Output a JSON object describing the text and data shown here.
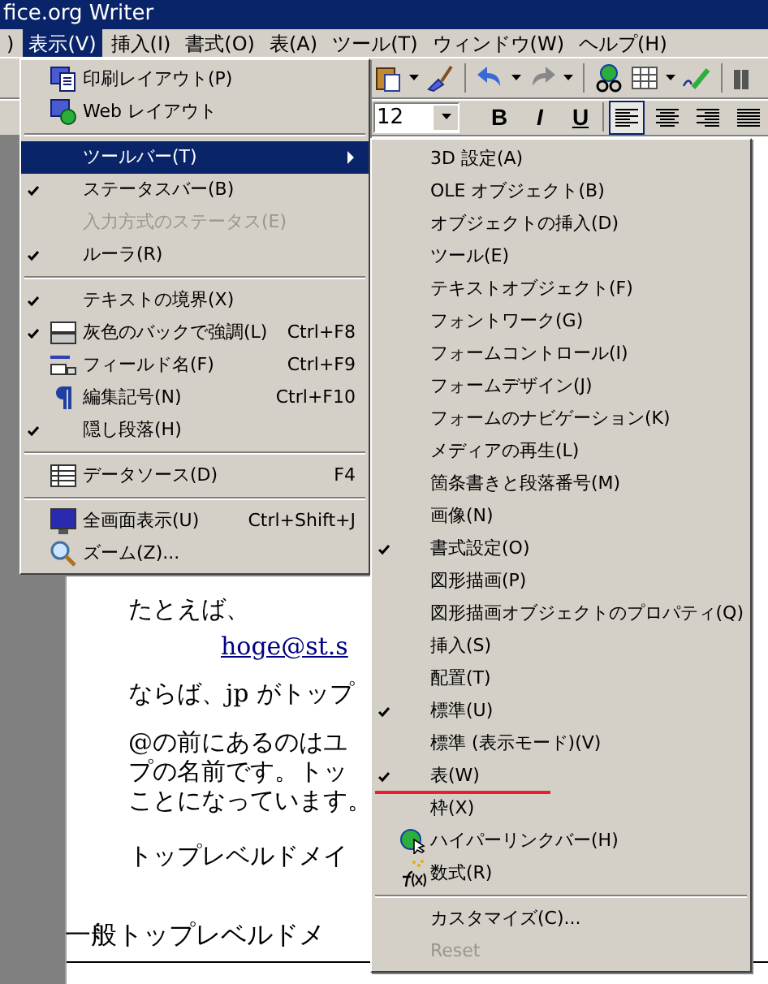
{
  "window": {
    "title": "fice.org Writer"
  },
  "menu_bar": [
    {
      "label": ")",
      "selected": false
    },
    {
      "label": "表示(V)",
      "selected": true
    },
    {
      "label": "挿入(I)",
      "selected": false
    },
    {
      "label": "書式(O)",
      "selected": false
    },
    {
      "label": "表(A)",
      "selected": false
    },
    {
      "label": "ツール(T)",
      "selected": false
    },
    {
      "label": "ウィンドウ(W)",
      "selected": false
    },
    {
      "label": "ヘルプ(H)",
      "selected": false
    }
  ],
  "format_bar": {
    "font_size": "12",
    "text_buttons": [
      {
        "label": "B",
        "pressed": false
      },
      {
        "label": "I",
        "pressed": false
      },
      {
        "label": "U",
        "pressed": false
      }
    ],
    "align_buttons": [
      {
        "selected": true
      },
      {
        "selected": false
      },
      {
        "selected": false
      },
      {
        "selected": false
      }
    ]
  },
  "document": {
    "blocks": [
      {
        "kind": "text",
        "lines": [
          "たとえば、"
        ]
      },
      {
        "kind": "link",
        "lines": [
          "hoge@st.s"
        ]
      },
      {
        "kind": "text",
        "lines": [
          "ならば、jp がトップ"
        ]
      },
      {
        "kind": "text",
        "lines": [
          "@の前にあるのはユ",
          "プの名前です。トッ",
          "ことになっています。"
        ]
      },
      {
        "kind": "text",
        "lines": [
          "トップレベルドメイ"
        ]
      },
      {
        "kind": "heading",
        "lines": [
          "一般トップレベルドメ"
        ]
      }
    ]
  },
  "view_menu": [
    {
      "kind": "item",
      "label": "印刷レイアウト(P)",
      "checked": false,
      "disabled": false,
      "selected": false
    },
    {
      "kind": "item",
      "label": "Web レイアウト",
      "checked": false,
      "disabled": false,
      "selected": false
    },
    {
      "kind": "separator"
    },
    {
      "kind": "submenu",
      "label": "ツールバー(T)",
      "checked": false,
      "disabled": false,
      "selected": true
    },
    {
      "kind": "item",
      "label": "ステータスバー(B)",
      "checked": true,
      "disabled": false,
      "selected": false
    },
    {
      "kind": "item",
      "label": "入力方式のステータス(E)",
      "checked": false,
      "disabled": true,
      "selected": false
    },
    {
      "kind": "item",
      "label": "ルーラ(R)",
      "checked": true,
      "disabled": false,
      "selected": false
    },
    {
      "kind": "separator"
    },
    {
      "kind": "item",
      "label": "テキストの境界(X)",
      "checked": true,
      "disabled": false,
      "selected": false
    },
    {
      "kind": "item",
      "label": "灰色のバックで強調(L)",
      "shortcut": "Ctrl+F8",
      "checked": true,
      "disabled": false,
      "selected": false
    },
    {
      "kind": "item",
      "label": "フィールド名(F)",
      "shortcut": "Ctrl+F9",
      "checked": false,
      "disabled": false,
      "selected": false
    },
    {
      "kind": "item",
      "label": "編集記号(N)",
      "shortcut": "Ctrl+F10",
      "checked": false,
      "disabled": false,
      "selected": false
    },
    {
      "kind": "item",
      "label": "隠し段落(H)",
      "checked": true,
      "disabled": false,
      "selected": false
    },
    {
      "kind": "separator"
    },
    {
      "kind": "item",
      "label": "データソース(D)",
      "shortcut": "F4",
      "checked": false,
      "disabled": false,
      "selected": false
    },
    {
      "kind": "separator"
    },
    {
      "kind": "item",
      "label": "全画面表示(U)",
      "shortcut": "Ctrl+Shift+J",
      "checked": false,
      "disabled": false,
      "selected": false
    },
    {
      "kind": "item",
      "label": "ズーム(Z)...",
      "checked": false,
      "disabled": false,
      "selected": false
    }
  ],
  "toolbars_menu": [
    {
      "kind": "item",
      "label": "3D 設定(A)",
      "checked": false,
      "disabled": false,
      "underlined": false
    },
    {
      "kind": "item",
      "label": "OLE オブジェクト(B)",
      "checked": false,
      "disabled": false,
      "underlined": false
    },
    {
      "kind": "item",
      "label": "オブジェクトの挿入(D)",
      "checked": false,
      "disabled": false,
      "underlined": false
    },
    {
      "kind": "item",
      "label": "ツール(E)",
      "checked": false,
      "disabled": false,
      "underlined": false
    },
    {
      "kind": "item",
      "label": "テキストオブジェクト(F)",
      "checked": false,
      "disabled": false,
      "underlined": false
    },
    {
      "kind": "item",
      "label": "フォントワーク(G)",
      "checked": false,
      "disabled": false,
      "underlined": false
    },
    {
      "kind": "item",
      "label": "フォームコントロール(I)",
      "checked": false,
      "disabled": false,
      "underlined": false
    },
    {
      "kind": "item",
      "label": "フォームデザイン(J)",
      "checked": false,
      "disabled": false,
      "underlined": false
    },
    {
      "kind": "item",
      "label": "フォームのナビゲーション(K)",
      "checked": false,
      "disabled": false,
      "underlined": false
    },
    {
      "kind": "item",
      "label": "メディアの再生(L)",
      "checked": false,
      "disabled": false,
      "underlined": false
    },
    {
      "kind": "item",
      "label": "箇条書きと段落番号(M)",
      "checked": false,
      "disabled": false,
      "underlined": false
    },
    {
      "kind": "item",
      "label": "画像(N)",
      "checked": false,
      "disabled": false,
      "underlined": false
    },
    {
      "kind": "item",
      "label": "書式設定(O)",
      "checked": true,
      "disabled": false,
      "underlined": false
    },
    {
      "kind": "item",
      "label": "図形描画(P)",
      "checked": false,
      "disabled": false,
      "underlined": false
    },
    {
      "kind": "item",
      "label": "図形描画オブジェクトのプロパティ(Q)",
      "checked": false,
      "disabled": false,
      "underlined": false
    },
    {
      "kind": "item",
      "label": "挿入(S)",
      "checked": false,
      "disabled": false,
      "underlined": false
    },
    {
      "kind": "item",
      "label": "配置(T)",
      "checked": false,
      "disabled": false,
      "underlined": false
    },
    {
      "kind": "item",
      "label": "標準(U)",
      "checked": true,
      "disabled": false,
      "underlined": false
    },
    {
      "kind": "item",
      "label": "標準 (表示モード)(V)",
      "checked": false,
      "disabled": false,
      "underlined": false
    },
    {
      "kind": "item",
      "label": "表(W)",
      "checked": true,
      "disabled": false,
      "underlined": true
    },
    {
      "kind": "item",
      "label": "枠(X)",
      "checked": false,
      "disabled": false,
      "underlined": false
    },
    {
      "kind": "item",
      "label": "ハイパーリンクバー(H)",
      "checked": false,
      "disabled": false,
      "underlined": false
    },
    {
      "kind": "item",
      "label": "数式(R)",
      "checked": false,
      "disabled": false,
      "underlined": false
    },
    {
      "kind": "separator"
    },
    {
      "kind": "item",
      "label": "カスタマイズ(C)...",
      "checked": false,
      "disabled": false,
      "underlined": false
    },
    {
      "kind": "item",
      "label": "Reset",
      "checked": false,
      "disabled": true,
      "underlined": false
    }
  ]
}
